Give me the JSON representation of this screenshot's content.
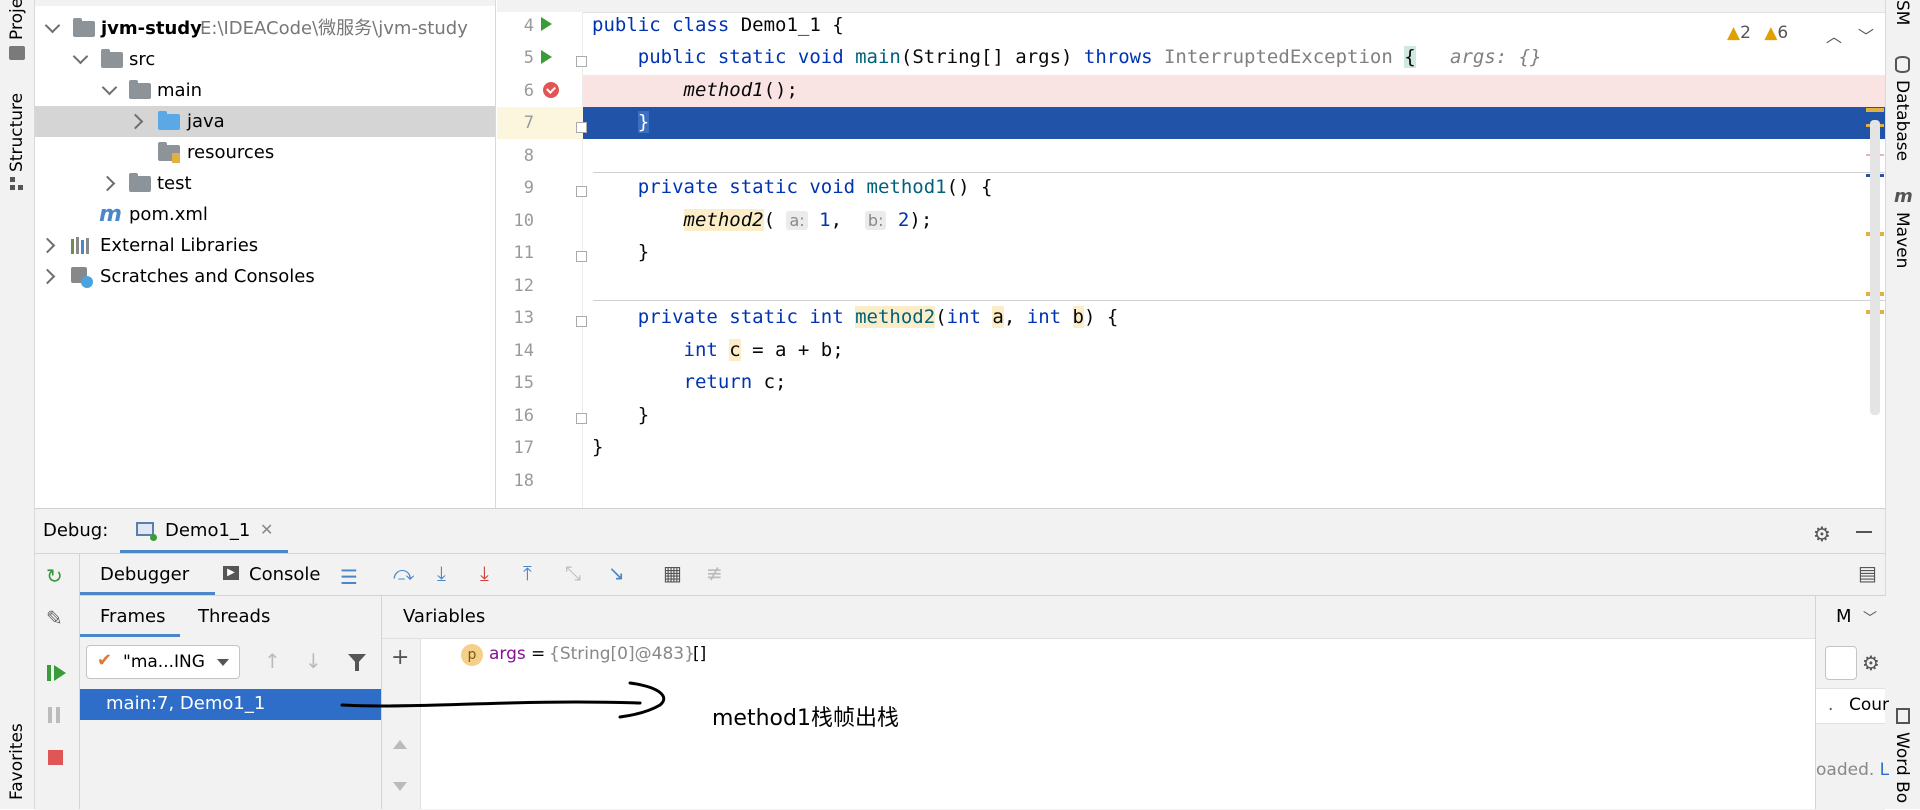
{
  "left_strip": {
    "project_tab": "Proje",
    "structure_tab": "Structure",
    "favorites_tab": "Favorites"
  },
  "right_strip": {
    "top_tab": "SM",
    "database_tab": "Database",
    "maven_tab": "Maven",
    "wordbook_tab": "Word Bo"
  },
  "project_tree": {
    "root_name": "jvm-study",
    "root_path": "E:\\IDEACode\\微服务\\jvm-study",
    "items": [
      {
        "label": "src"
      },
      {
        "label": "main"
      },
      {
        "label": "java"
      },
      {
        "label": "resources"
      },
      {
        "label": "test"
      },
      {
        "label": "pom.xml"
      },
      {
        "label": "External Libraries"
      },
      {
        "label": "Scratches and Consoles"
      }
    ]
  },
  "editor": {
    "line_numbers": [
      "4",
      "5",
      "6",
      "7",
      "8",
      "9",
      "10",
      "11",
      "12",
      "13",
      "14",
      "15",
      "16",
      "17",
      "18"
    ],
    "inline_value_hint": "args: {}",
    "param_hint_a": "a:",
    "param_hint_b": "b:",
    "warnings_a": "2",
    "warnings_b": "6",
    "accent_breakpoint": "#e05555",
    "current_line_color": "#2154a8",
    "breakpoint_line_color": "#fae3e3"
  },
  "debug": {
    "title": "Debug:",
    "session_tab": "Demo1_1",
    "tabs": {
      "debugger": "Debugger",
      "console": "Console"
    },
    "frames_tabs": {
      "frames": "Frames",
      "threads": "Threads"
    },
    "thread_selector": "\"ma...ING",
    "frame_selected": "main:7, Demo1_1",
    "variables_header": "Variables",
    "variable": {
      "badge": "p",
      "name": "args",
      "eq": "=",
      "value": "{String[0]@483}",
      "extra": "[]"
    },
    "annotation": "method1栈帧出栈",
    "right_panel_tab": "M",
    "right_count": "Cour",
    "right_loaded_prefix": "oaded.",
    "right_loaded_link": "L",
    "right_dots": "."
  }
}
